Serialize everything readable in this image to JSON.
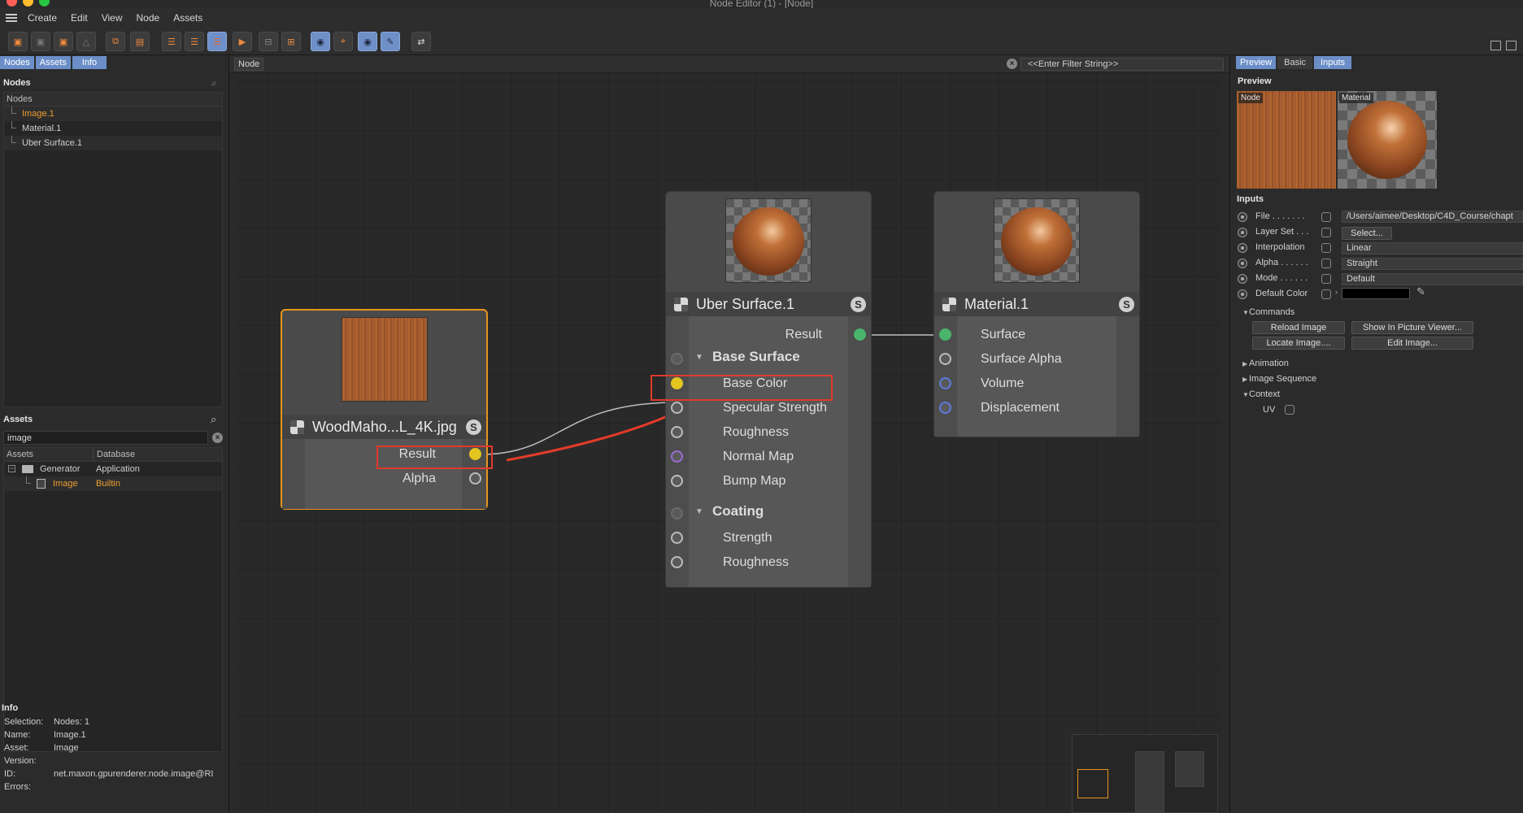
{
  "window": {
    "title": "Node Editor (1) - [Node]"
  },
  "menu": {
    "items": [
      "Create",
      "Edit",
      "View",
      "Node",
      "Assets"
    ]
  },
  "left": {
    "tabs": [
      "Nodes",
      "Assets",
      "Info"
    ],
    "nodes_title": "Nodes",
    "nodes_header": "Nodes",
    "nodes": [
      "Image.1",
      "Material.1",
      "Uber Surface.1"
    ],
    "assets_title": "Assets",
    "assets_search": "image",
    "assets_headers": [
      "Assets",
      "Database"
    ],
    "assets_rows": [
      {
        "name": "Generator",
        "db": "Application"
      },
      {
        "name": "Image",
        "db": "Builtin"
      }
    ],
    "info_title": "Info",
    "info": [
      {
        "k": "Selection:",
        "v": "Nodes: 1"
      },
      {
        "k": "Name:",
        "v": "Image.1"
      },
      {
        "k": "Asset:",
        "v": "Image"
      },
      {
        "k": "Version:",
        "v": ""
      },
      {
        "k": "ID:",
        "v": "net.maxon.gpurenderer.node.image@RI"
      },
      {
        "k": "Errors:",
        "v": ""
      }
    ]
  },
  "canvas": {
    "breadcrumb": "Node",
    "filter_placeholder": "<<Enter Filter String>>"
  },
  "nodes": {
    "image": {
      "title": "WoodMaho...L_4K.jpg",
      "badge": "S",
      "outputs": [
        "Result",
        "Alpha"
      ]
    },
    "uber": {
      "title": "Uber Surface.1",
      "badge": "S",
      "output": "Result",
      "group1": "Base Surface",
      "group1_ports": [
        "Base Color",
        "Specular Strength",
        "Roughness",
        "Normal Map",
        "Bump Map"
      ],
      "group2": "Coating",
      "group2_ports": [
        "Strength",
        "Roughness"
      ]
    },
    "material": {
      "title": "Material.1",
      "badge": "S",
      "inputs": [
        "Surface",
        "Surface Alpha",
        "Volume",
        "Displacement"
      ]
    }
  },
  "right": {
    "tabs": [
      "Preview",
      "Basic",
      "Inputs"
    ],
    "preview_title": "Preview",
    "thumb_labels": [
      "Node",
      "Material"
    ],
    "inputs_title": "Inputs",
    "params": [
      {
        "label": "File . . . . . . .",
        "value": "/Users/aimee/Desktop/C4D_Course/chapt"
      },
      {
        "label": "Layer Set . . .",
        "value": "Select..."
      },
      {
        "label": "Interpolation",
        "value": "Linear"
      },
      {
        "label": "Alpha . . . . . .",
        "value": "Straight"
      },
      {
        "label": "Mode . . . . . .",
        "value": "Default"
      },
      {
        "label": "Default Color",
        "value": ""
      }
    ],
    "commands_title": "Commands",
    "commands": [
      "Reload Image",
      "Show In Picture Viewer...",
      "Locate Image....",
      "Edit Image..."
    ],
    "sections": [
      "Animation",
      "Image Sequence",
      "Context"
    ],
    "uv_label": "UV"
  },
  "colors": {
    "accent": "#6b8ec8",
    "selection": "#e8951d",
    "highlight": "#e23b2a",
    "yellow_port": "#e3c520",
    "green_port": "#49b56c"
  }
}
